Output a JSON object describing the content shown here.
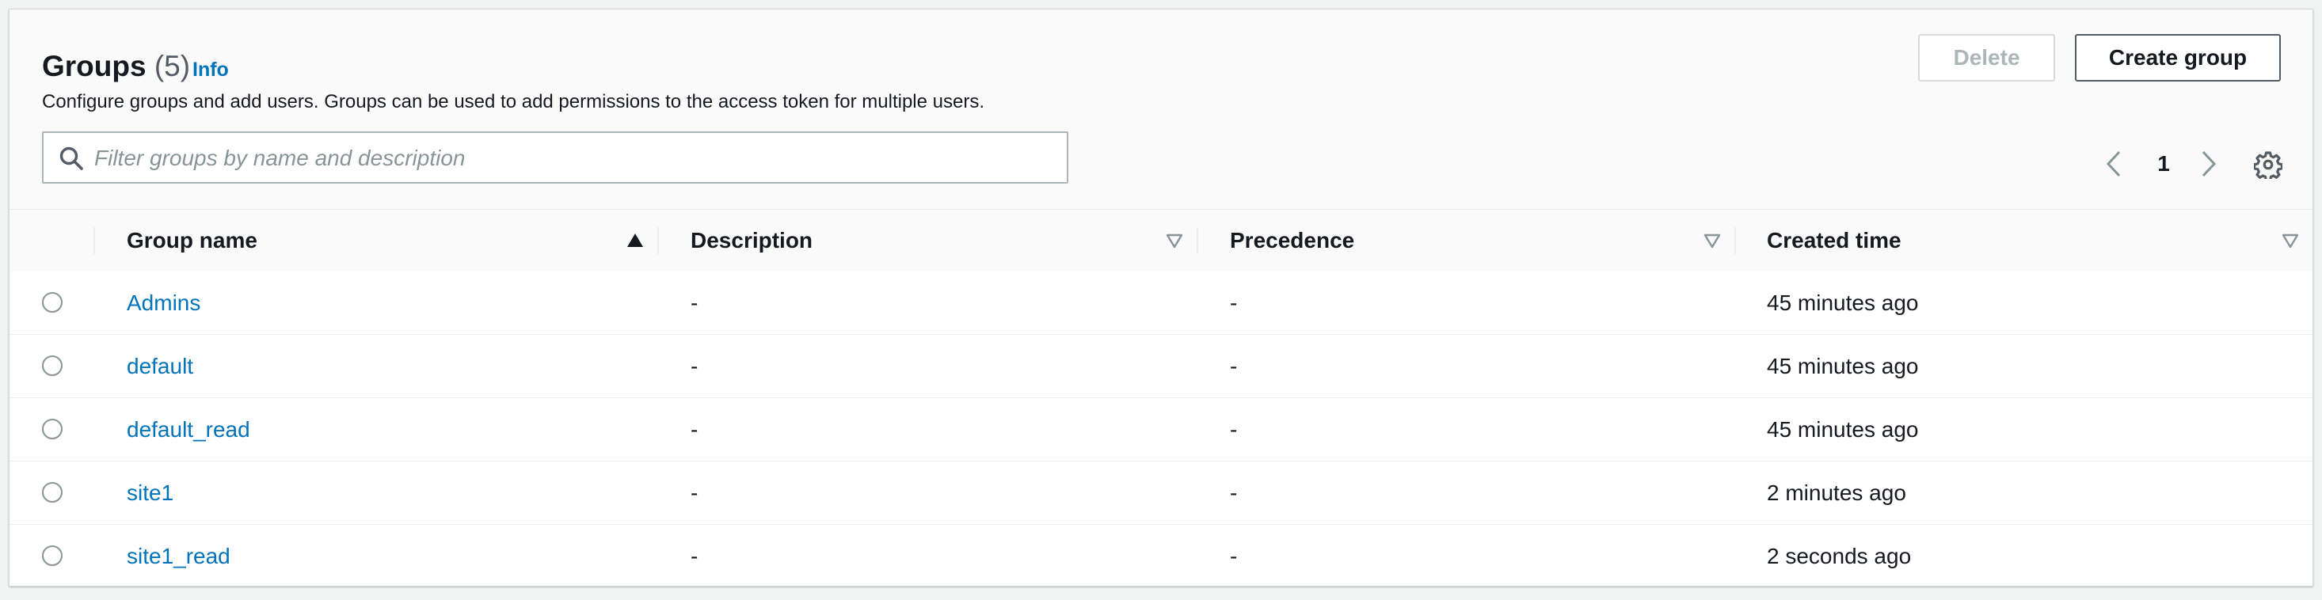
{
  "header": {
    "title": "Groups",
    "count": "(5)",
    "info_label": "Info",
    "description": "Configure groups and add users. Groups can be used to add permissions to the access token for multiple users.",
    "delete_label": "Delete",
    "create_label": "Create group"
  },
  "search": {
    "placeholder": "Filter groups by name and description",
    "value": ""
  },
  "pagination": {
    "current_page": "1"
  },
  "table": {
    "columns": [
      {
        "label": "Group name",
        "sort": "ascending"
      },
      {
        "label": "Description",
        "sort": "none"
      },
      {
        "label": "Precedence",
        "sort": "none"
      },
      {
        "label": "Created time",
        "sort": "none"
      }
    ],
    "rows": [
      {
        "name": "Admins",
        "description": "-",
        "precedence": "-",
        "created": "45 minutes ago"
      },
      {
        "name": "default",
        "description": "-",
        "precedence": "-",
        "created": "45 minutes ago"
      },
      {
        "name": "default_read",
        "description": "-",
        "precedence": "-",
        "created": "45 minutes ago"
      },
      {
        "name": "site1",
        "description": "-",
        "precedence": "-",
        "created": "2 minutes ago"
      },
      {
        "name": "site1_read",
        "description": "-",
        "precedence": "-",
        "created": "2 seconds ago"
      }
    ]
  },
  "icons": {
    "search": "search-icon",
    "prev": "chevron-left-icon",
    "next": "chevron-right-icon",
    "settings": "gear-icon",
    "sort_asc": "caret-up-icon",
    "sort_none": "caret-down-outline-icon"
  },
  "colors": {
    "link": "#0073bb",
    "text": "#16191f",
    "muted": "#879596",
    "disabled": "#aab7b8",
    "border": "#eaeded"
  }
}
